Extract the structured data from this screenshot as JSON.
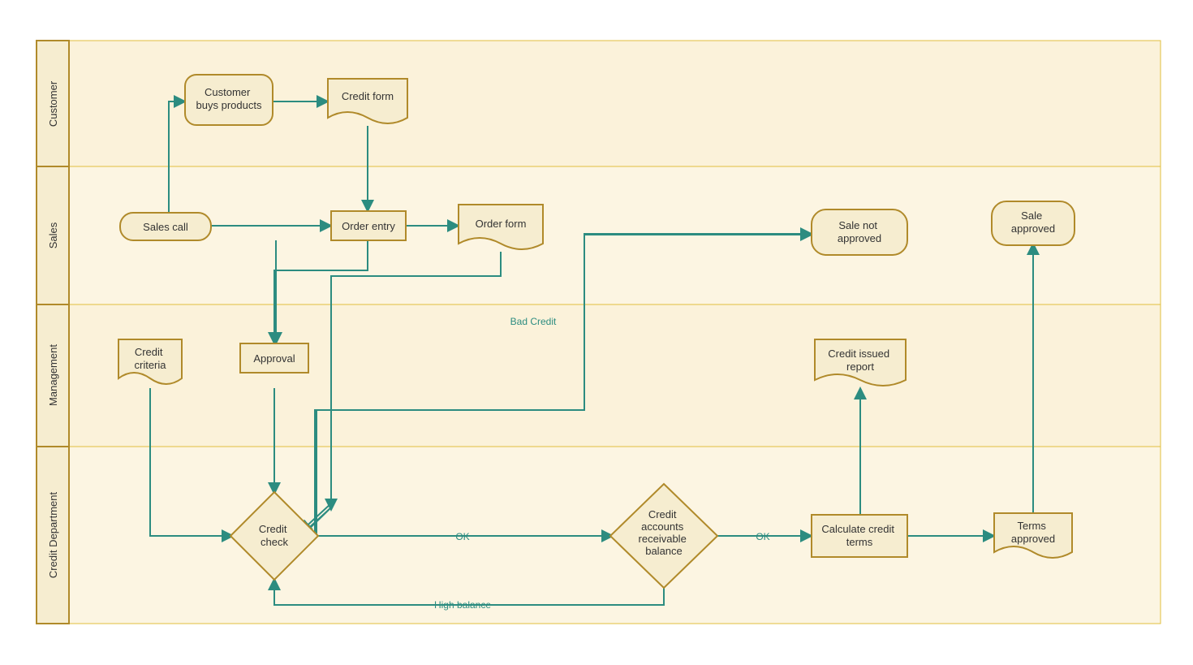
{
  "diagram": {
    "type": "swimlane-flowchart",
    "orientation": "horizontal-lanes",
    "accent_color": "#2c8c80",
    "shape_border": "#b08a2a",
    "shape_fill": "#f6edd0",
    "lane_fill": "#fbf2da",
    "lane_border": "#e2bf3e"
  },
  "lanes": {
    "customer": "Customer",
    "sales": "Sales",
    "management": "Management",
    "credit": "Credit Department"
  },
  "nodes": {
    "sales_call": "Sales call",
    "customer_buys": "Customer\nbuys products",
    "credit_form": "Credit form",
    "order_entry": "Order entry",
    "order_form": "Order form",
    "credit_criteria": "Credit\ncriteria",
    "approval": "Approval",
    "credit_check": "Credit\ncheck",
    "credit_ar_balance": "Credit\naccounts\nreceivable\nbalance",
    "calculate_terms": "Calculate credit\nterms",
    "credit_issued_report": "Credit issued\nreport",
    "terms_approved": "Terms\napproved",
    "sale_not_approved": "Sale not\napproved",
    "sale_approved": "Sale\napproved"
  },
  "edges": {
    "bad_credit": "Bad Credit",
    "ok1": "OK",
    "ok2": "OK",
    "high_balance": "High balance"
  }
}
